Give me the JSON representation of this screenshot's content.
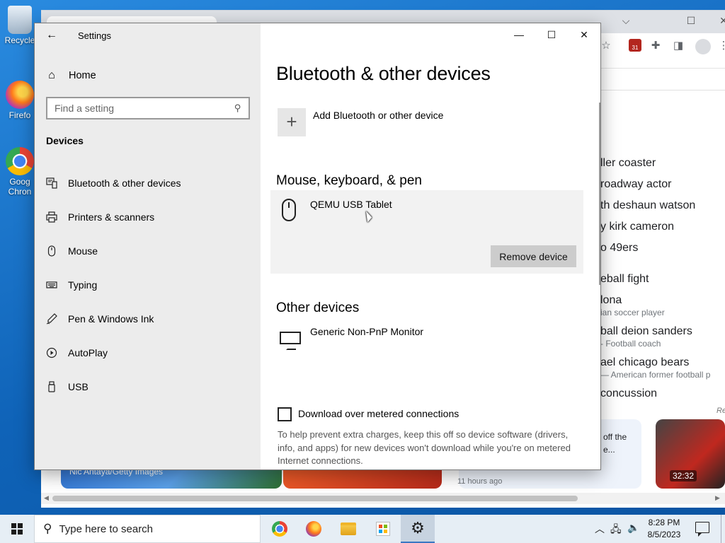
{
  "desktop": {
    "icons": [
      {
        "label": "Recycle",
        "name": "recycle-bin-icon"
      },
      {
        "label": "Firefo",
        "name": "firefox-icon"
      },
      {
        "label": "Goog\nChron",
        "name": "chrome-icon"
      }
    ]
  },
  "browser": {
    "trends": [
      {
        "text": "ller coaster"
      },
      {
        "text": "roadway actor"
      },
      {
        "text": "th deshaun watson"
      },
      {
        "text": "y kirk cameron"
      },
      {
        "text": "o 49ers"
      },
      {
        "text": "eball fight"
      },
      {
        "text": "lona",
        "sub": "ian soccer player"
      },
      {
        "text": "ball deion sanders",
        "sub": "- Football coach"
      },
      {
        "text": "ael chicago bears",
        "sub": "— American former football p"
      },
      {
        "text": "concussion"
      }
    ],
    "news_caption": "Nic Antaya/Getty Images",
    "news_card_text": [
      "off the",
      "e..."
    ],
    "news_card_meta": "11 hours ago",
    "video_time": "32:32",
    "calendar_badge": "31",
    "partial_right_text": "Re"
  },
  "settings": {
    "window_title": "Settings",
    "nav": {
      "home_label": "Home",
      "search_placeholder": "Find a setting",
      "section_title": "Devices",
      "items": [
        {
          "label": "Bluetooth & other devices",
          "icon": "bluetooth-keyboard-icon"
        },
        {
          "label": "Printers & scanners",
          "icon": "printer-icon"
        },
        {
          "label": "Mouse",
          "icon": "mouse-icon"
        },
        {
          "label": "Typing",
          "icon": "keyboard-icon"
        },
        {
          "label": "Pen & Windows Ink",
          "icon": "pen-icon"
        },
        {
          "label": "AutoPlay",
          "icon": "autoplay-icon"
        },
        {
          "label": "USB",
          "icon": "usb-icon"
        }
      ]
    },
    "content": {
      "page_title": "Bluetooth & other devices",
      "add_device_label": "Add Bluetooth or other device",
      "mouse_section_title": "Mouse, keyboard, & pen",
      "mouse_device_name": "QEMU USB Tablet",
      "remove_button_label": "Remove device",
      "other_section_title": "Other devices",
      "monitor_device_name": "Generic Non-PnP Monitor",
      "metered_checkbox_label": "Download over metered connections",
      "metered_checked": false,
      "help_text": "To help prevent extra charges, keep this off so device software (drivers, info, and apps) for new devices won't download while you're on metered Internet connections."
    }
  },
  "taskbar": {
    "search_placeholder": "Type here to search",
    "time": "8:28 PM",
    "date": "8/5/2023",
    "apps": [
      {
        "name": "chrome-taskbar-button"
      },
      {
        "name": "firefox-taskbar-button"
      },
      {
        "name": "file-explorer-taskbar-button"
      },
      {
        "name": "microsoft-store-taskbar-button"
      },
      {
        "name": "settings-taskbar-button",
        "active": true
      }
    ]
  }
}
